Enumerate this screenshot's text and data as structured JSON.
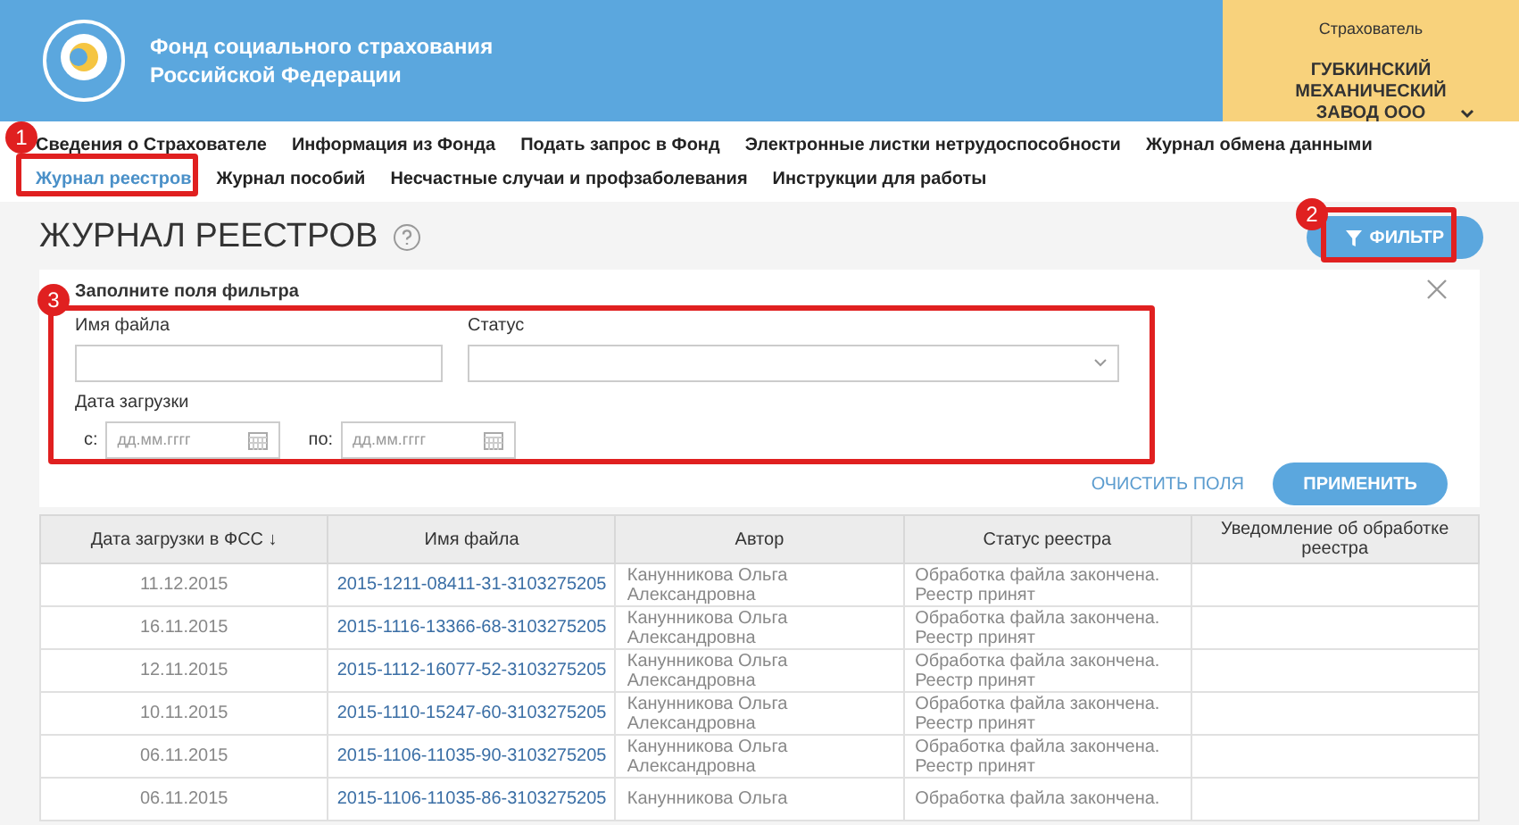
{
  "header": {
    "org_name": "Фонд социального страхования Российской Федерации",
    "insurer_label": "Страхователь",
    "insurer_name": "ГУБКИНСКИЙ МЕХАНИЧЕСКИЙ ЗАВОД ООО"
  },
  "nav": {
    "rows": [
      [
        {
          "label": "Сведения о Страхователе",
          "selected": false
        },
        {
          "label": "Информация из Фонда",
          "selected": false
        },
        {
          "label": "Подать запрос в Фонд",
          "selected": false
        },
        {
          "label": "Электронные листки нетрудоспособности",
          "selected": false
        },
        {
          "label": "Журнал обмена данными",
          "selected": false
        }
      ],
      [
        {
          "label": "Журнал реестров",
          "selected": true
        },
        {
          "label": "Журнал пособий",
          "selected": false
        },
        {
          "label": "Несчастные случаи и профзаболевания",
          "selected": false
        },
        {
          "label": "Инструкции для работы",
          "selected": false
        }
      ]
    ]
  },
  "page_title": "ЖУРНАЛ РЕЕСТРОВ",
  "filter_button": "ФИЛЬТР",
  "filter": {
    "title": "Заполните поля фильтра",
    "file_name_label": "Имя файла",
    "status_label": "Статус",
    "date_label": "Дата загрузки",
    "from_label": "с:",
    "from_placeholder": "дд.мм.гггг",
    "to_label": "по:",
    "to_placeholder": "дд.мм.гггг",
    "clear_button": "ОЧИСТИТЬ ПОЛЯ",
    "apply_button": "ПРИМЕНИТЬ"
  },
  "table": {
    "columns": [
      "Дата загрузки в ФСС ↓",
      "Имя файла",
      "Автор",
      "Статус реестра",
      "Уведомление об обработке реестра"
    ],
    "rows": [
      [
        "11.12.2015",
        "2015-1211-08411-31-3103275205",
        "Канунникова Ольга Александровна",
        "Обработка файла закончена. Реестр принят"
      ],
      [
        "16.11.2015",
        "2015-1116-13366-68-3103275205",
        "Канунникова Ольга Александровна",
        "Обработка файла закончена. Реестр принят"
      ],
      [
        "12.11.2015",
        "2015-1112-16077-52-3103275205",
        "Канунникова Ольга Александровна",
        "Обработка файла закончена. Реестр принят"
      ],
      [
        "10.11.2015",
        "2015-1110-15247-60-3103275205",
        "Канунникова Ольга Александровна",
        "Обработка файла закончена. Реестр принят"
      ],
      [
        "06.11.2015",
        "2015-1106-11035-90-3103275205",
        "Канунникова Ольга Александровна",
        "Обработка файла закончена. Реестр принят"
      ],
      [
        "06.11.2015",
        "2015-1106-11035-86-3103275205",
        "Канунникова Ольга",
        "Обработка файла закончена."
      ]
    ]
  },
  "annotations": [
    "1",
    "2",
    "3"
  ]
}
